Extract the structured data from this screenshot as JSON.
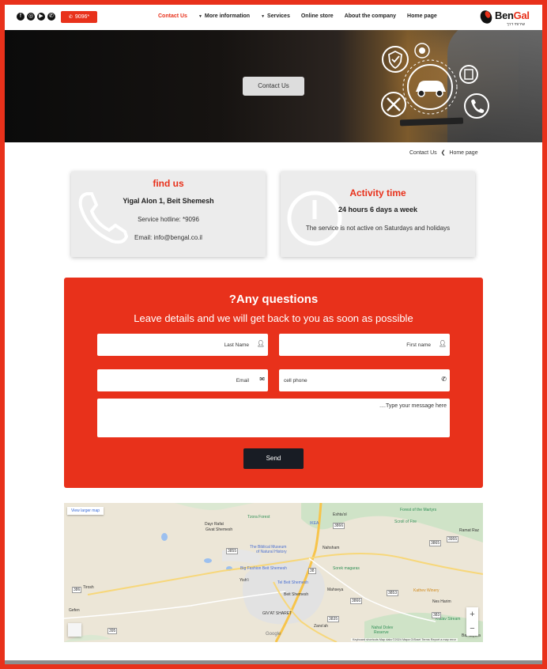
{
  "colors": {
    "brand": "#e8311b",
    "dark": "#181c24",
    "card_bg": "#ececec"
  },
  "header": {
    "social_icons": [
      "facebook-icon",
      "instagram-icon",
      "youtube-icon",
      "whatsapp-icon"
    ],
    "hotline_label": "9096*",
    "nav": [
      {
        "label": "Contact Us",
        "active": true,
        "dropdown": false
      },
      {
        "label": "More information",
        "active": false,
        "dropdown": true
      },
      {
        "label": "Services",
        "active": false,
        "dropdown": true
      },
      {
        "label": "Online store",
        "active": false,
        "dropdown": false
      },
      {
        "label": "About the company",
        "active": false,
        "dropdown": false
      },
      {
        "label": "Home page",
        "active": false,
        "dropdown": false
      }
    ],
    "logo": {
      "name_a": "Ben",
      "name_b": "Gal",
      "tagline": "שירותי דרך"
    }
  },
  "hero": {
    "button_label": "Contact Us"
  },
  "breadcrumb": {
    "current": "Contact Us",
    "separator": "❮",
    "home": "Home page"
  },
  "find_us": {
    "title": "find us",
    "address": "Yigal Alon 1, Beit Shemesh",
    "hotline": "Service hotline: *9096",
    "email": "Email: info@bengal.co.il"
  },
  "activity": {
    "title": "Activity time",
    "hours": "24 hours 6 days a week",
    "note": "The service is not active on Saturdays and holidays"
  },
  "form": {
    "title": "?Any questions",
    "subtitle": "Leave details and we will get back to you as soon as possible",
    "first_name_placeholder": "First name",
    "last_name_placeholder": "Last Name",
    "phone_placeholder": "cell phone",
    "email_placeholder": "Email",
    "message_placeholder": "....Type your message here",
    "send_label": "Send"
  },
  "map": {
    "larger_map_label": "View larger map",
    "labels": {
      "tzora_forest": "Tzora Forest",
      "eshtaol": "Eshta'ol",
      "forest_martyrs": "Forest of the Martyrs",
      "dayr_rafat": "Dayr Rafat",
      "givat_shemesh": "Givat Shemesh",
      "ikea": "IKEA",
      "scroll_fire": "Scroll of Fire",
      "ramat_raz": "Ramat Raz",
      "biblical_museum_1": "The Biblical Museum",
      "biblical_museum_2": "of Natural History",
      "nahsham": "Nahsham",
      "big_fashion": "Big Fashion Beit Shemesh",
      "sorek_caves": "Sorek magaras",
      "yishi": "Yish'i",
      "tel_beit_shemesh": "Tel Beit Shemesh",
      "beit_shemesh": "Beit Shemesh",
      "mahseya": "Mahseya",
      "kathev_winery": "Kathev Winery",
      "tirosh": "Tirosh",
      "nes_harim": "Nes Harim",
      "gefen": "Gefen",
      "giv_at_sharet": "GIV'AT SHARET",
      "zanoah": "Zano'ah",
      "ktalav_stream": "Ktalav Stream",
      "nahal_dolev_1": "Nahal Dolev",
      "nahal_dolev_2": "Reserve",
      "bar_giyora": "Bar Giyora",
      "road_3855": "3855",
      "road_3866": "3866",
      "road_375": "375",
      "road_38": "38",
      "road_3955": "3955",
      "road_386": "386",
      "road_3865": "3865",
      "road_3853": "3853",
      "road_3835": "3835",
      "road_395": "395",
      "road_3866b": "3866",
      "road_383": "383"
    },
    "zoom_in": "+",
    "zoom_out": "−",
    "google": "Google",
    "footer": "Keyboard shortcuts   Map data ©2024 Mapa GISrael   Terms   Report a map error"
  }
}
